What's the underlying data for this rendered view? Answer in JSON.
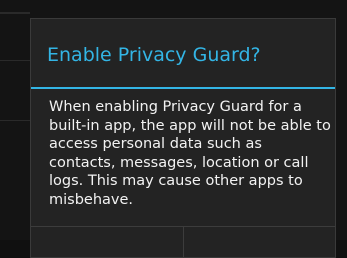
{
  "dialog": {
    "title": "Enable Privacy Guard?",
    "message": "When enabling Privacy Guard for a built-in app, the app will not be able to access personal data such as contacts, messages, location or call logs. This may cause other apps to misbehave."
  },
  "colors": {
    "accent": "#33b5e5",
    "dialog_bg": "#232323",
    "text": "#f2f2f2",
    "backdrop": "#141414"
  }
}
